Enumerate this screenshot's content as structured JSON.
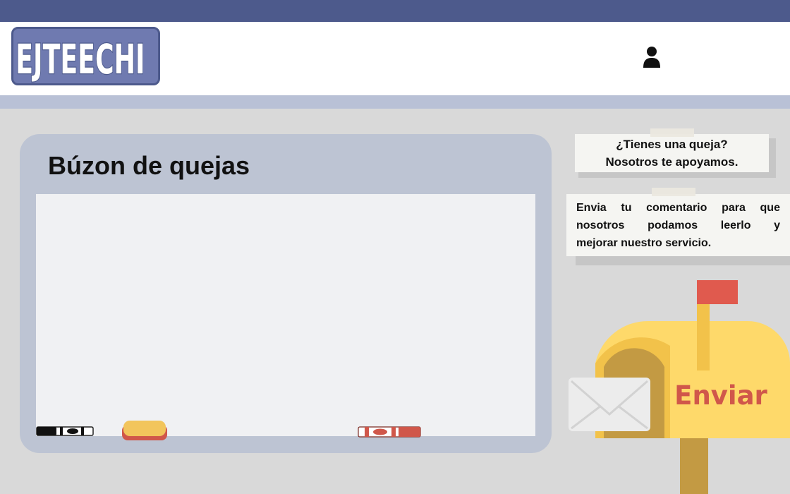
{
  "app": {
    "logo_text": "EJTEECHI"
  },
  "header": {
    "user_icon": "user-icon"
  },
  "board": {
    "title": "Búzon de quejas",
    "textarea_value": "",
    "textarea_placeholder": ""
  },
  "notes": {
    "note1": {
      "line1": "¿Tienes una queja?",
      "line2": "Nosotros te apoyamos."
    },
    "note2": {
      "line1_words": [
        "Envia",
        "tu",
        "comentario",
        "para",
        "que"
      ],
      "line2_words": [
        "nosotros",
        "podamos",
        "leerlo",
        "y"
      ],
      "line3": "mejorar nuestro servicio."
    }
  },
  "mailbox": {
    "send_label": "Enviar"
  },
  "colors": {
    "topbar": "#4d5a8c",
    "subbar": "#b9c1d6",
    "board": "#bdc4d3",
    "send_text": "#d0574a",
    "mailbox_yellow": "#fed96a",
    "flag_red": "#e05a4e"
  }
}
